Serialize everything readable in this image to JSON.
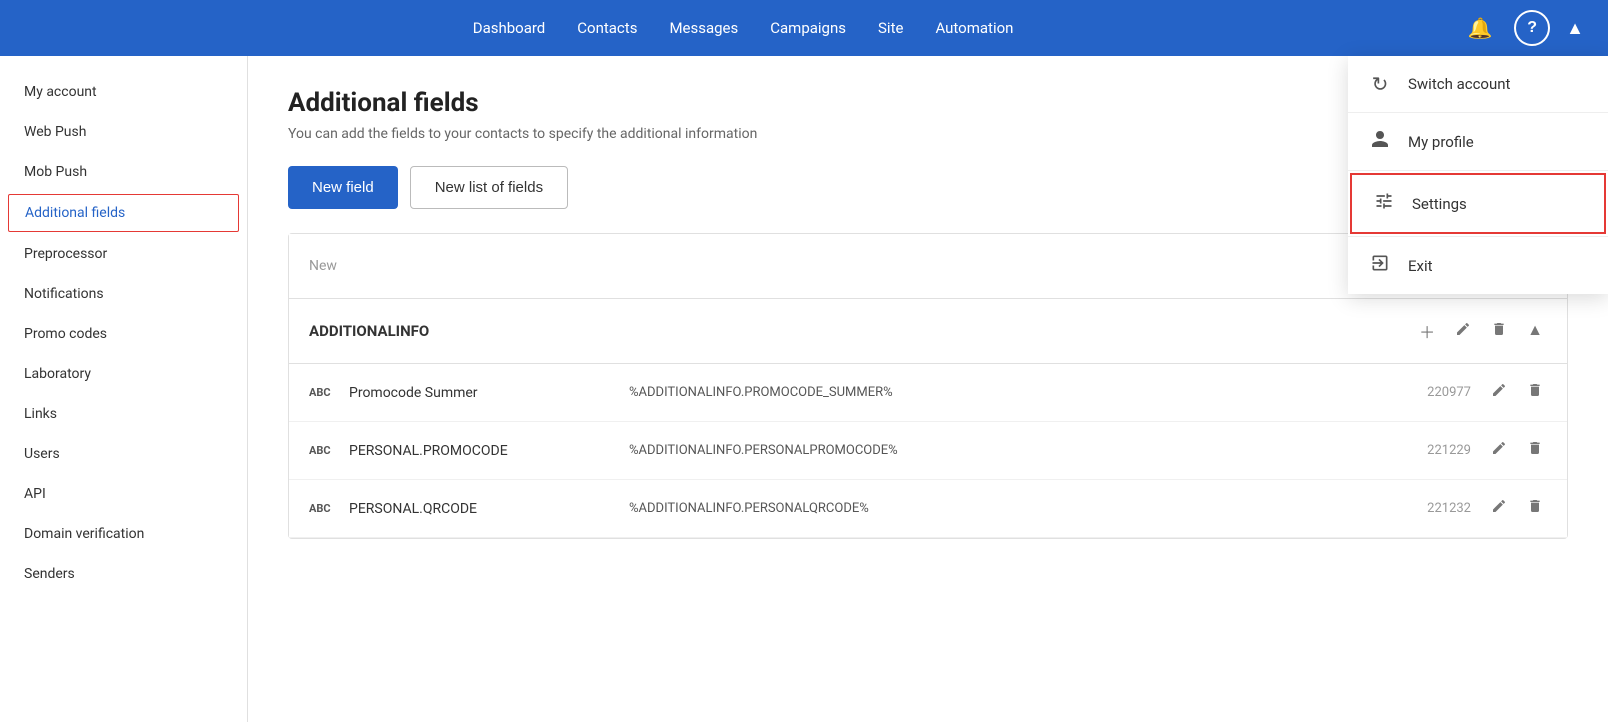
{
  "nav": {
    "links": [
      {
        "label": "Dashboard",
        "href": "#"
      },
      {
        "label": "Contacts",
        "href": "#"
      },
      {
        "label": "Messages",
        "href": "#"
      },
      {
        "label": "Campaigns",
        "href": "#"
      },
      {
        "label": "Site",
        "href": "#"
      },
      {
        "label": "Automation",
        "href": "#"
      }
    ],
    "bell_icon": "🔔",
    "help_icon": "?",
    "chevron_icon": "▲"
  },
  "dropdown": {
    "items": [
      {
        "id": "switch-account",
        "icon": "↻",
        "label": "Switch account"
      },
      {
        "id": "my-profile",
        "icon": "👤",
        "label": "My profile"
      },
      {
        "id": "settings",
        "icon": "⚙",
        "label": "Settings",
        "active": true
      },
      {
        "id": "exit",
        "icon": "⬚",
        "label": "Exit"
      }
    ]
  },
  "sidebar": {
    "items": [
      {
        "id": "my-account",
        "label": "My account"
      },
      {
        "id": "web-push",
        "label": "Web Push"
      },
      {
        "id": "mob-push",
        "label": "Mob Push"
      },
      {
        "id": "additional-fields",
        "label": "Additional fields",
        "active": true
      },
      {
        "id": "preprocessor",
        "label": "Preprocessor"
      },
      {
        "id": "notifications",
        "label": "Notifications"
      },
      {
        "id": "promo-codes",
        "label": "Promo codes"
      },
      {
        "id": "laboratory",
        "label": "Laboratory"
      },
      {
        "id": "links",
        "label": "Links"
      },
      {
        "id": "users",
        "label": "Users"
      },
      {
        "id": "api",
        "label": "API"
      },
      {
        "id": "domain-verification",
        "label": "Domain verification"
      },
      {
        "id": "senders",
        "label": "Senders"
      }
    ]
  },
  "main": {
    "title": "Additional fields",
    "subtitle": "You can add the fields to your contacts to specify the additional information",
    "btn_new_field": "New field",
    "btn_new_list": "New list of fields",
    "sections": [
      {
        "id": "new-section",
        "label": "New",
        "is_title": false
      },
      {
        "id": "additionalinfo-section",
        "label": "ADDITIONALINFO",
        "is_title": true,
        "fields": [
          {
            "type": "ABC",
            "name": "Promocode Summer",
            "macro": "%ADDITIONALINFO.PROMOCODE_SUMMER%",
            "id": "220977"
          },
          {
            "type": "ABC",
            "name": "PERSONAL.PROMOCODE",
            "macro": "%ADDITIONALINFO.PERSONALPROMOCODE%",
            "id": "221229"
          },
          {
            "type": "ABC",
            "name": "PERSONAL.QRCODE",
            "macro": "%ADDITIONALINFO.PERSONALQRCODE%",
            "id": "221232"
          }
        ]
      }
    ]
  }
}
